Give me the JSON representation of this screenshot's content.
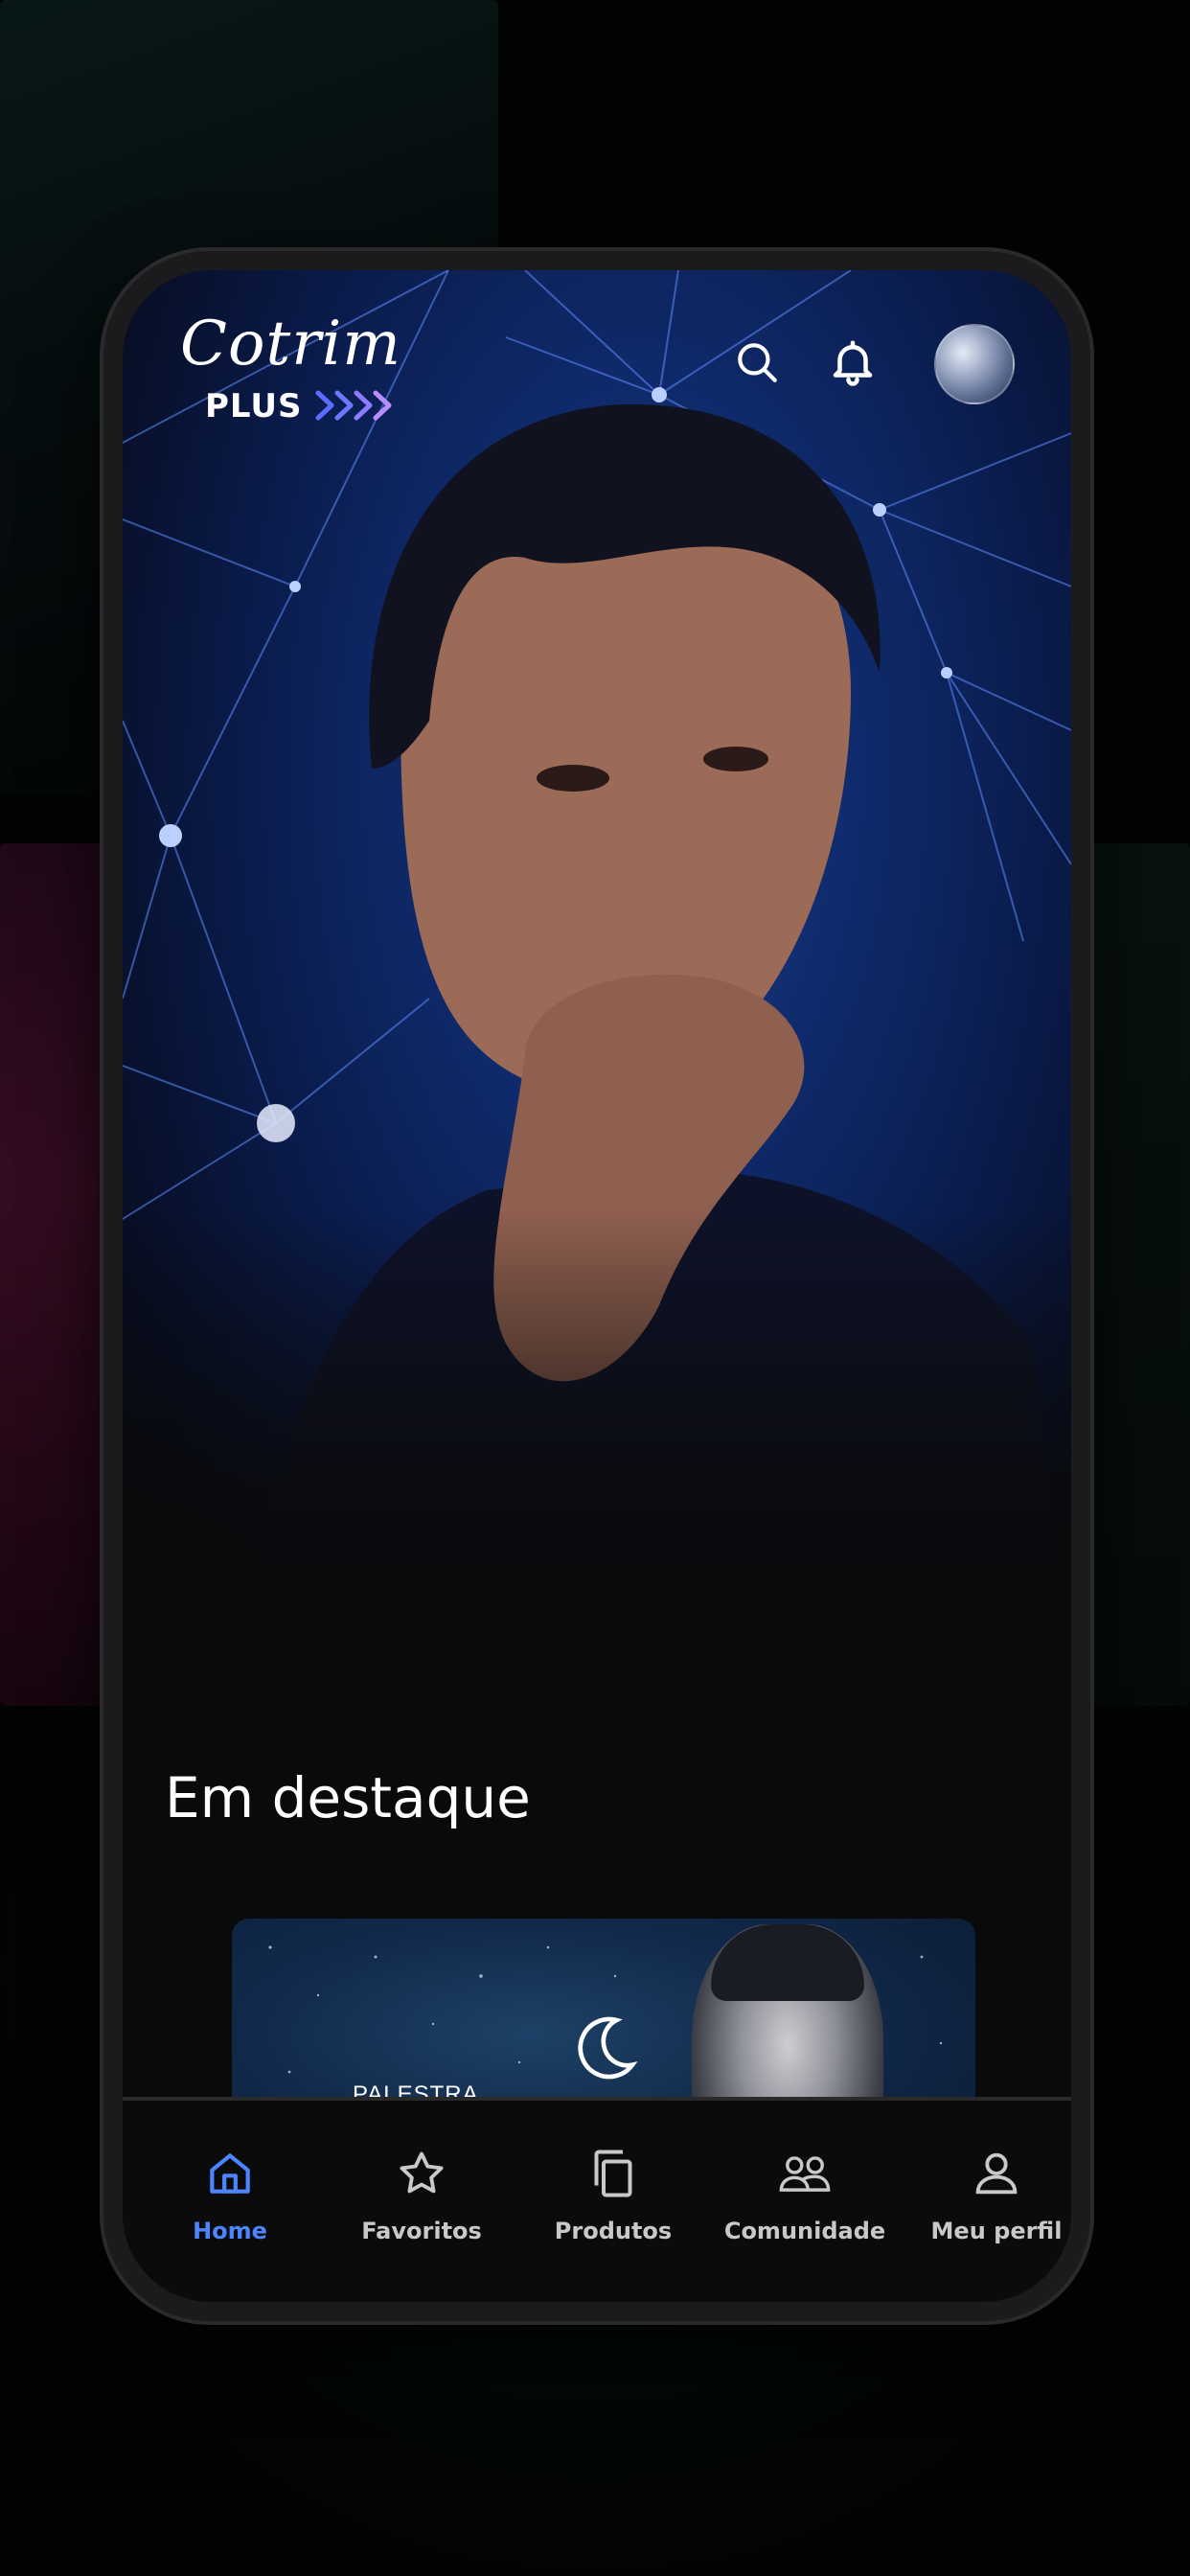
{
  "app": {
    "brand_name": "Cotrim",
    "brand_sub": "PLUS"
  },
  "header": {
    "icons": [
      "search-icon",
      "bell-icon"
    ]
  },
  "section": {
    "title": "Em destaque"
  },
  "featured": {
    "card_label": "PALESTRA"
  },
  "tabs": [
    {
      "label": "Home",
      "icon": "home-icon",
      "active": true
    },
    {
      "label": "Favoritos",
      "icon": "star-icon",
      "active": false
    },
    {
      "label": "Produtos",
      "icon": "copy-icon",
      "active": false
    },
    {
      "label": "Comunidade",
      "icon": "community-icon",
      "active": false
    },
    {
      "label": "Meu perfil",
      "icon": "person-icon",
      "active": false
    }
  ],
  "colors": {
    "accent": "#4d84ff",
    "background": "#0a0a0a",
    "hero_blue": "#0f2a6b"
  }
}
